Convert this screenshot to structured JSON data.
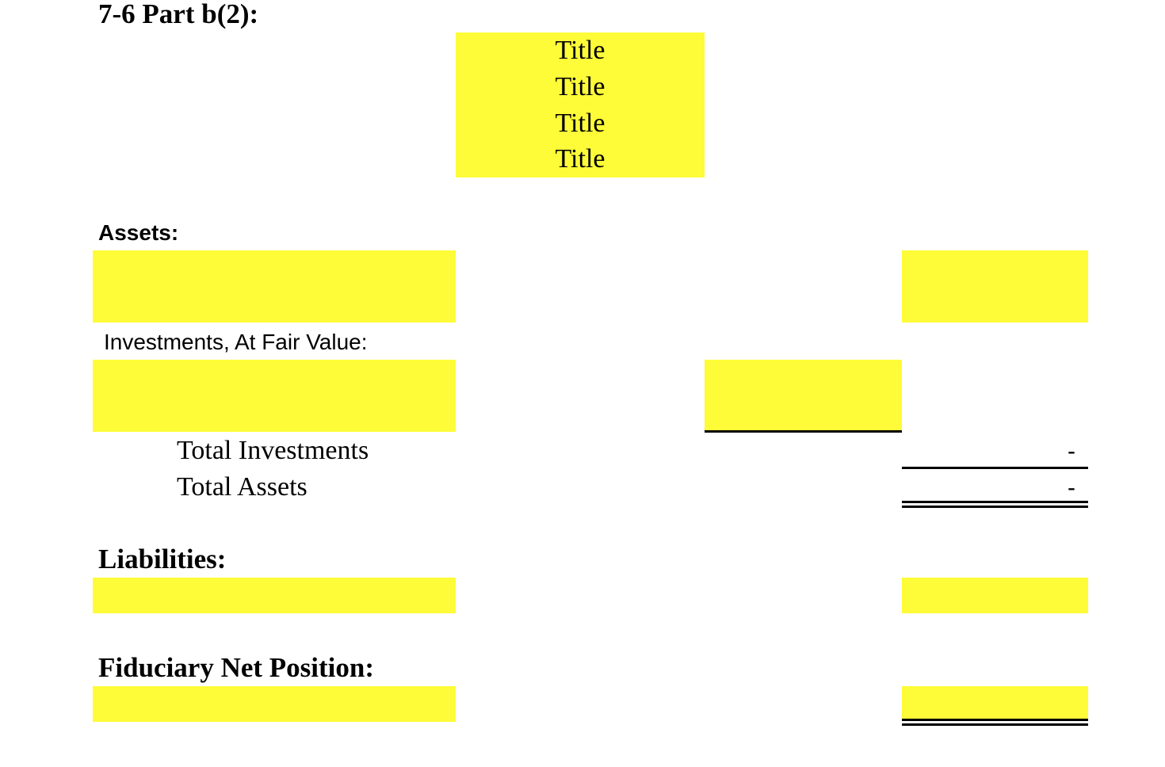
{
  "document": {
    "heading": "7-6 Part b(2):",
    "title_lines": [
      "Title",
      "Title",
      "Title",
      "Title"
    ],
    "highlight_color": "#fefb38",
    "sections": {
      "assets": {
        "label": "Assets:",
        "input_left": "",
        "input_right": ""
      },
      "investments": {
        "label": "Investments, At Fair Value:",
        "input_left": "",
        "input_mid": ""
      },
      "total_investments": {
        "label": "Total Investments",
        "value": "-"
      },
      "total_assets": {
        "label": "Total Assets",
        "value": "-"
      },
      "liabilities": {
        "label": "Liabilities:",
        "input_left": "",
        "input_right": ""
      },
      "fiduciary_net_position": {
        "label": "Fiduciary Net Position:",
        "input_left": "",
        "input_right": ""
      }
    }
  }
}
